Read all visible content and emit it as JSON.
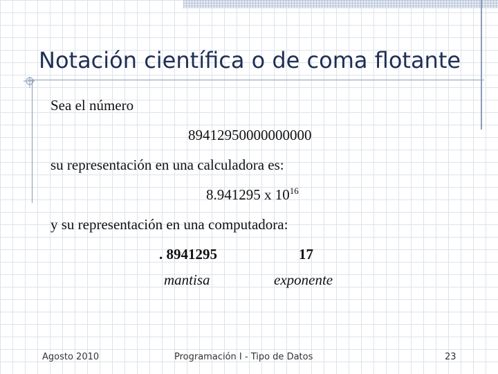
{
  "slide": {
    "title": "Notación científica o de coma flotante",
    "intro": "Sea el número",
    "number": "89412950000000000",
    "calc_intro": "su representación en una calculadora es:",
    "calc_base": "8.941295 x 10",
    "calc_exponent": "16",
    "comp_intro": "y su representación en una computadora:",
    "mantissa_value": ". 8941295",
    "exponent_value": "17",
    "mantissa_label": "mantisa",
    "exponent_label": "exponente"
  },
  "footer": {
    "date": "Agosto 2010",
    "course": "Programación I - Tipo de Datos",
    "page": "23"
  },
  "colors": {
    "title": "#1f2f55",
    "rule": "#8b9bb8",
    "grid": "#dde3ea"
  }
}
